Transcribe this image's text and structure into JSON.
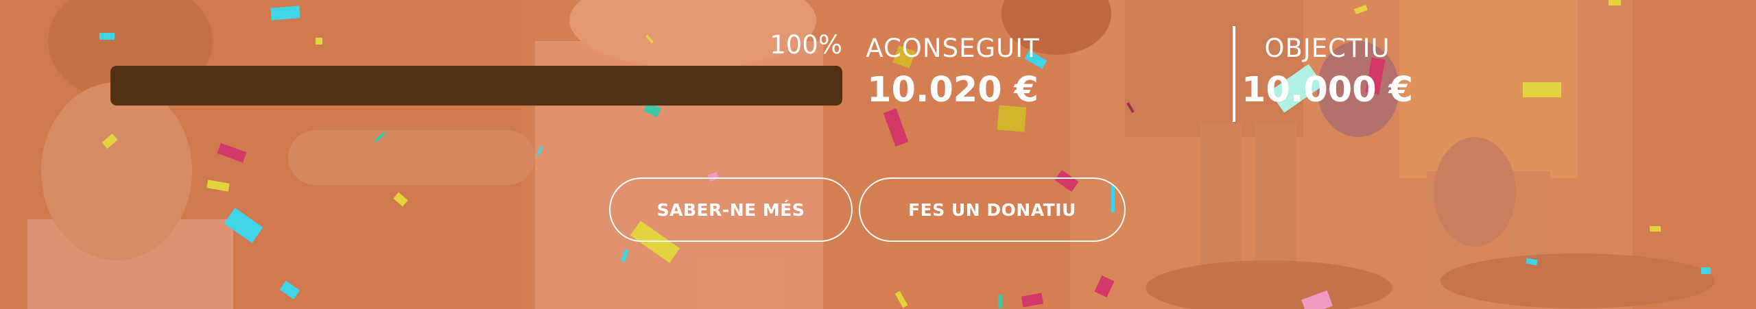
{
  "campaign": {
    "progress_percent_label": "100%",
    "progress_fraction": 1.0,
    "raised_label": "ACONSEGUIT",
    "raised_value": "10.020 €",
    "goal_label": "OBJECTIU",
    "goal_value": "10.000 €"
  },
  "actions": {
    "more_info_label": "SABER-NE MÉS",
    "donate_label": "FES UN DONATIU"
  },
  "colors": {
    "overlay": "#d2845a",
    "progress_fill": "#513014",
    "text": "#ffffff",
    "confetti": [
      "#3fd4e6",
      "#d43868",
      "#e3d43f",
      "#aef0e3",
      "#f29ac2",
      "#3cc7a8"
    ]
  }
}
